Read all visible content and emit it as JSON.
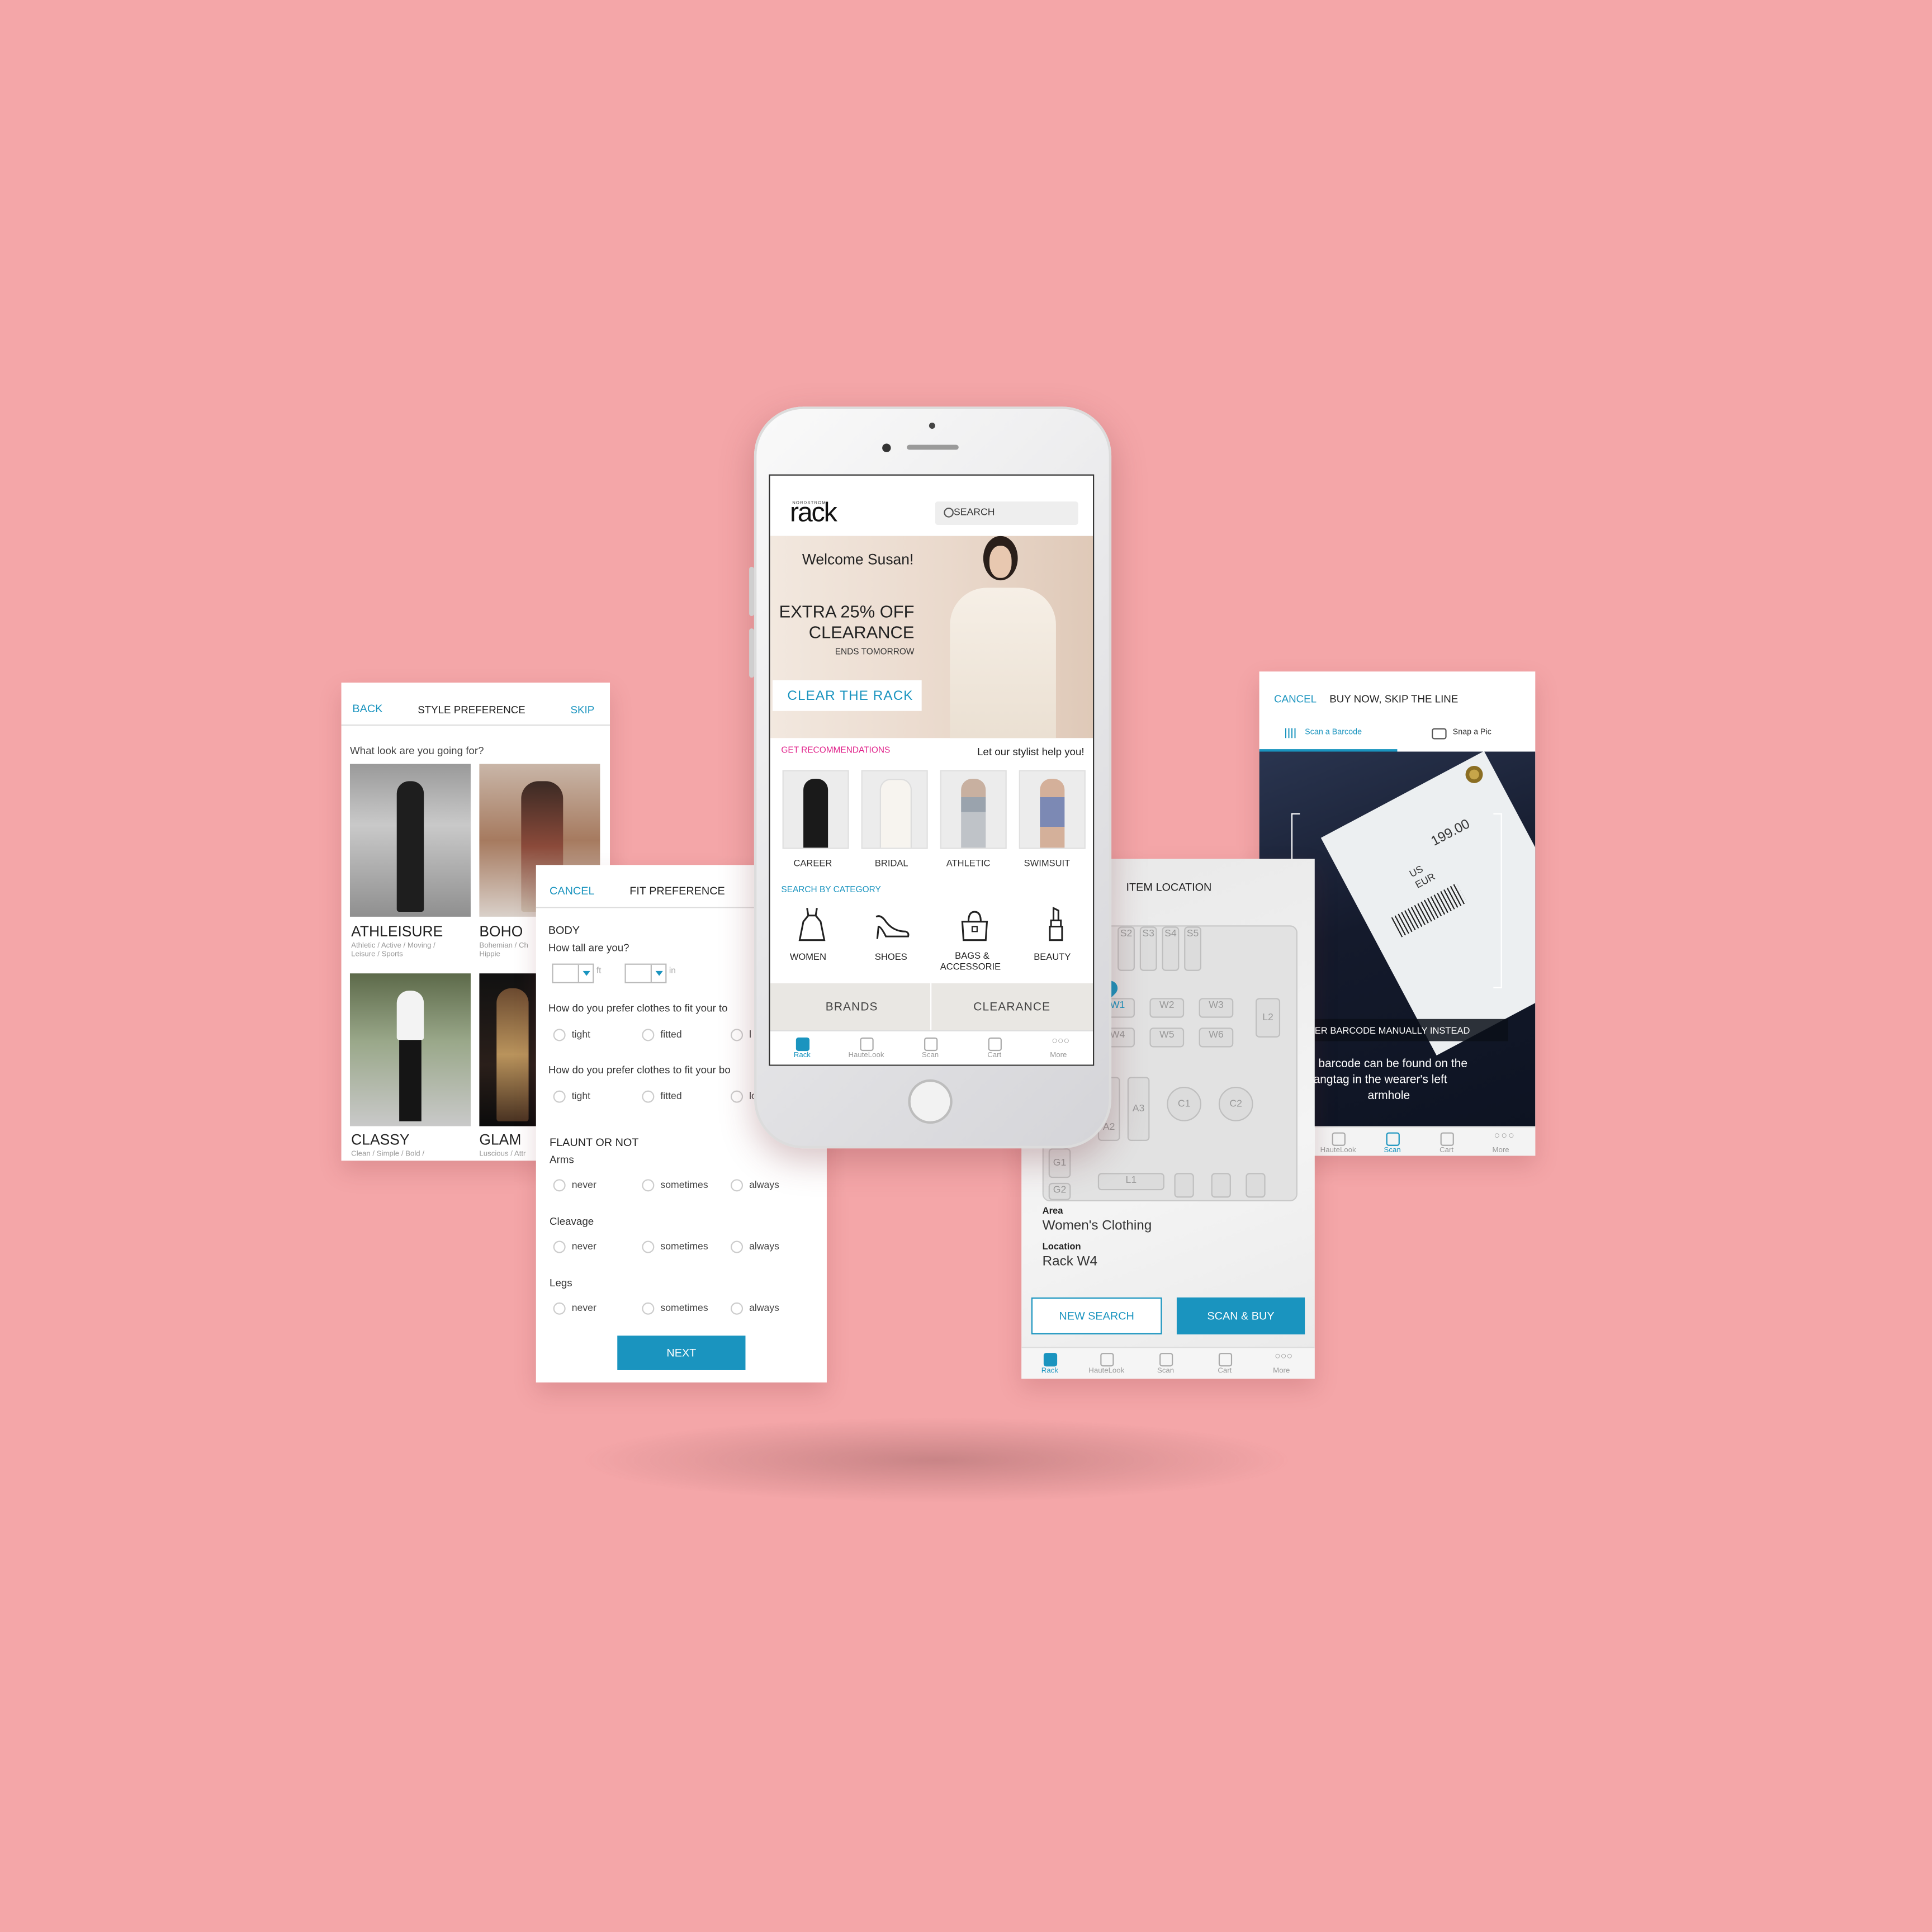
{
  "colors": {
    "background": "#f4a6a8",
    "accent": "#1a94bf",
    "pink_accent": "#e0218a"
  },
  "style_pref": {
    "back": "BACK",
    "title": "STYLE PREFERENCE",
    "skip": "SKIP",
    "question": "What look are you going for?",
    "looks": [
      {
        "name": "ATHLEISURE",
        "desc1": "Athletic / Active / Moving /",
        "desc2": "Leisure / Sports"
      },
      {
        "name": "BOHO",
        "desc1": "Bohemian / Ch",
        "desc2": "Hippie"
      },
      {
        "name": "CLASSY",
        "desc1": "Clean / Simple / Bold /",
        "desc2": ""
      },
      {
        "name": "GLAM",
        "desc1": "Luscious / Attr",
        "desc2": ""
      }
    ]
  },
  "fit_pref": {
    "cancel": "CANCEL",
    "title": "FIT PREFERENCE",
    "body": "BODY",
    "height_q": "How tall are you?",
    "ft": "ft",
    "in": "in",
    "q1": "How do you prefer clothes to fit your to",
    "q2": "How do you prefer clothes to fit your bo",
    "tight": "tight",
    "fitted": "fitted",
    "q1_third": "l",
    "q2_third": "lo",
    "flaunt": "FLAUNT OR NOT",
    "parts": [
      "Arms",
      "Cleavage",
      "Legs"
    ],
    "never": "never",
    "sometimes": "sometimes",
    "always": "always",
    "next": "NEXT"
  },
  "phone": {
    "brand_small": "NORDSTROM",
    "brand": "rack",
    "search": "SEARCH",
    "welcome": "Welcome Susan!",
    "promo1": "EXTRA 25% OFF",
    "promo2": "CLEARANCE",
    "ends": "ENDS TOMORROW",
    "cta": "CLEAR THE RACK",
    "recs": "GET RECOMMENDATIONS",
    "stylist": "Let our stylist help you!",
    "rec_items": [
      "CAREER",
      "BRIDAL",
      "ATHLETIC",
      "SWIMSUIT"
    ],
    "search_cat": "SEARCH BY CATEGORY",
    "categories": [
      "WOMEN",
      "SHOES",
      "BAGS &",
      "ACCESSORIE",
      "BEAUTY"
    ],
    "brands": "BRANDS",
    "clearance": "CLEARANCE",
    "tabs": [
      "Rack",
      "HauteLook",
      "Scan",
      "Cart",
      "More"
    ]
  },
  "item_location": {
    "title": "ITEM LOCATION",
    "shelves_s": [
      "S2",
      "S3",
      "S4",
      "S5"
    ],
    "shelves_w": [
      "W1",
      "W2",
      "W3",
      "W4",
      "W5",
      "W6"
    ],
    "others": [
      "L2",
      "A3",
      "A2",
      "C1",
      "C2",
      "G1",
      "G2",
      "L1"
    ],
    "area_label": "Area",
    "area": "Women's Clothing",
    "location_label": "Location",
    "location": "Rack W4",
    "new_search": "NEW SEARCH",
    "scan_buy": "SCAN & BUY",
    "tabs": [
      "Rack",
      "HauteLook",
      "Scan",
      "Cart",
      "More"
    ]
  },
  "scanner": {
    "cancel": "CANCEL",
    "title": "BUY NOW, SKIP THE LINE",
    "tab1": "Scan a Barcode",
    "tab2": "Snap a Pic",
    "price": "199.00",
    "tag1": "US",
    "tag2": "EUR",
    "manual": "ER BARCODE MANUALLY INSTEAD",
    "hint1": "barcode can be found on the",
    "hint2": "angtag in the wearer's left",
    "hint3": "armhole",
    "tabs": [
      "HauteLook",
      "Scan",
      "Cart",
      "More"
    ]
  }
}
